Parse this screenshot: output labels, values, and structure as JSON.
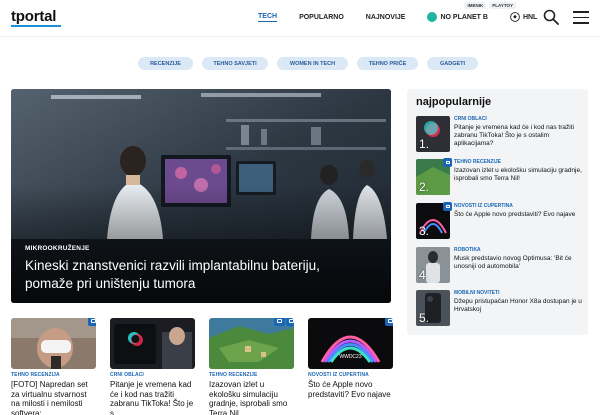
{
  "header": {
    "logo": "tportal",
    "mini_links": [
      "IMENIK",
      "PLAYTOY"
    ],
    "nav": [
      "TECH",
      "POPULARNO",
      "NAJNOVIJE",
      "NO PLANET B",
      "HNL"
    ],
    "icons": {
      "search": "search-icon",
      "menu": "hamburger-menu-icon"
    }
  },
  "tags": [
    "RECENZIJE",
    "TEHNO SAVJETI",
    "WOMEN IN TECH",
    "TEHNO PRIČE",
    "GADGETI"
  ],
  "hero": {
    "category": "MIKROOKRUŽENJE",
    "title": "Kineski znanstvenici razvili implantabilnu bateriju, pomaže pri uništenju tumora"
  },
  "cards": [
    {
      "category": "TEHNO RECENZIJA",
      "title": "[FOTO] Napredan set za virtualnu stvarnost na milosti i nemilosti softvera:"
    },
    {
      "category": "CRNI OBLACI",
      "title": "Pitanje je vremena kad će i kod nas tražiti zabranu TikToka! Što je s"
    },
    {
      "category": "TEHNO RECENZIJE",
      "title": "Izazovan izlet u ekološku simulaciju gradnje, isprobali smo Terra Nil"
    },
    {
      "category": "NOVOSTI IZ CUPERTINA",
      "title": "Što će Apple novo predstaviti? Evo najave"
    }
  ],
  "sidebar": {
    "heading": "najpopularnije",
    "items": [
      {
        "num": "1.",
        "category": "CRNI OBLACI",
        "title": "Pitanje je vremena kad će i kod nas tražiti zabranu TikToka! Što je s ostalim aplikacijama?"
      },
      {
        "num": "2.",
        "category": "TEHNO RECENZIJE",
        "title": "Izazovan izlet u ekološku simulaciju gradnje, isprobali smo Terra Nil!"
      },
      {
        "num": "3.",
        "category": "NOVOSTI IZ CUPERTINA",
        "title": "Što će Apple novo predstaviti? Evo najave"
      },
      {
        "num": "4.",
        "category": "ROBOTIKA",
        "title": "Musk predstavio novog Optimusa: 'Bit će unosniji od automobila'"
      },
      {
        "num": "5.",
        "category": "MOBILNI NOVITETI",
        "title": "Džepu pristupačan Honor X8a dostupan je u Hrvatskoj"
      }
    ]
  },
  "colors": {
    "accent": "#1a66b5",
    "logo_underline": "#1c8fd6",
    "pill_bg": "#dbe8f6",
    "sidebar_bg": "#f2f4f6",
    "planet": "#1fb5a5"
  }
}
